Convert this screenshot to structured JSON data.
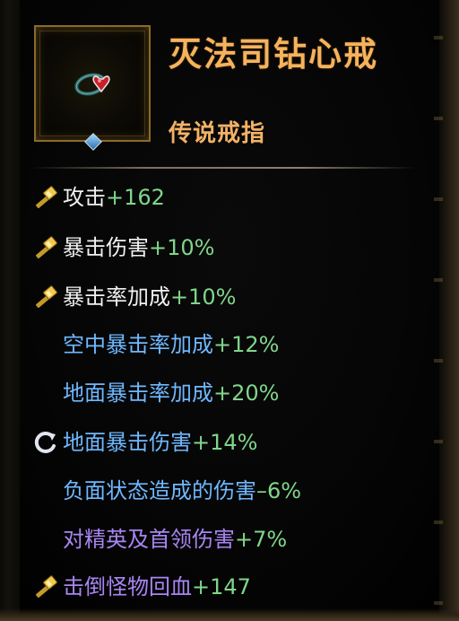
{
  "item": {
    "name": "灭法司钻心戒",
    "type": "传说戒指",
    "icon": "heart-ring-icon"
  },
  "stats": [
    {
      "icon": "hammer-icon",
      "label": "攻击",
      "value": "+162",
      "label_color": "#f1f1f1",
      "value_color": "#7fd68a"
    },
    {
      "icon": "hammer-icon",
      "label": "暴击伤害",
      "value": "+10%",
      "label_color": "#f1f1f1",
      "value_color": "#7fd68a"
    },
    {
      "icon": "hammer-icon",
      "label": "暴击率加成",
      "value": "+10%",
      "label_color": "#f1f1f1",
      "value_color": "#7fd68a"
    },
    {
      "icon": "",
      "label": "空中暴击率加成",
      "value": "+12%",
      "label_color": "#6fb8ff",
      "value_color": "#7fd68a"
    },
    {
      "icon": "",
      "label": "地面暴击率加成",
      "value": "+20%",
      "label_color": "#6fb8ff",
      "value_color": "#7fd68a"
    },
    {
      "icon": "refresh-icon",
      "label": "地面暴击伤害",
      "value": "+14%",
      "label_color": "#6fb8ff",
      "value_color": "#7fd68a"
    },
    {
      "icon": "",
      "label": "负面状态造成的伤害",
      "value": "–6%",
      "label_color": "#6fb8ff",
      "value_color": "#7fd68a"
    },
    {
      "icon": "",
      "label": "对精英及首领伤害",
      "value": "+7%",
      "label_color": "#a886f2",
      "value_color": "#7fd68a"
    },
    {
      "icon": "hammer-icon",
      "label": "击倒怪物回血",
      "value": "+147",
      "label_color": "#a886f2",
      "value_color": "#7fd68a"
    }
  ],
  "colors": {
    "title": "#f5b35c",
    "frame": "#8c6a2a",
    "gem": "#2f6fb0"
  }
}
